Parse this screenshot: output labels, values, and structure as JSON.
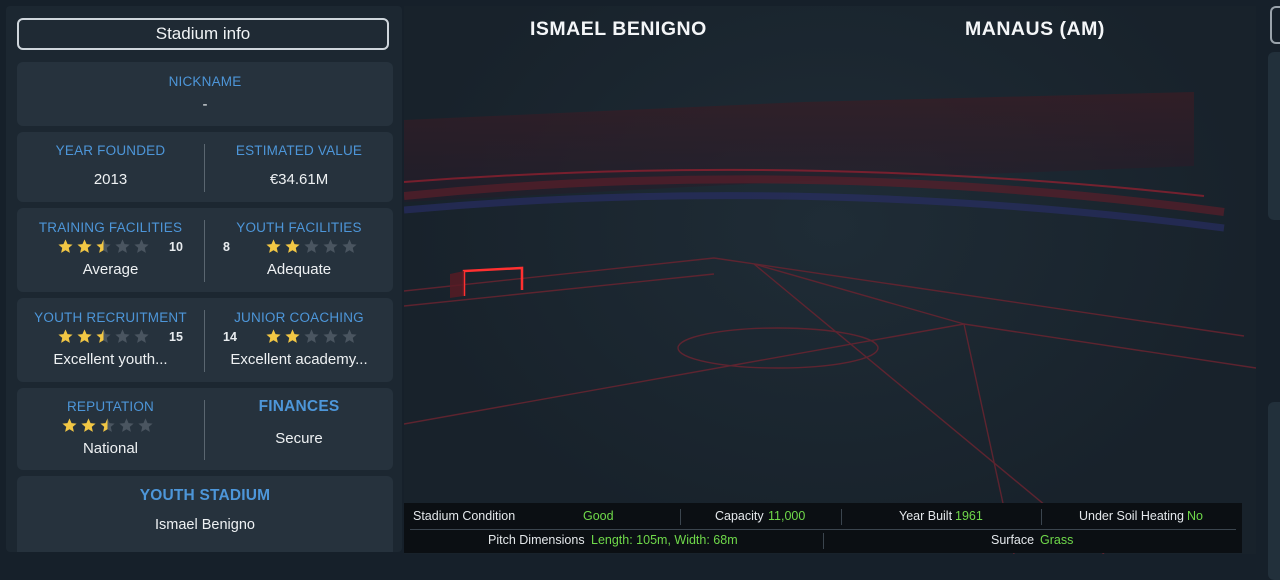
{
  "panel": {
    "stadium_button": "Stadium info",
    "nickname": {
      "label": "NICKNAME",
      "value": "-"
    },
    "year_founded": {
      "label": "YEAR FOUNDED",
      "value": "2013"
    },
    "estimated_value": {
      "label": "ESTIMATED VALUE",
      "value": "€34.61M"
    },
    "training_facilities": {
      "label": "TRAINING FACILITIES",
      "stars": 2.5,
      "number": "10",
      "rating": "Average"
    },
    "youth_facilities": {
      "label": "YOUTH FACILITIES",
      "stars": 2,
      "number": "8",
      "rating": "Adequate"
    },
    "youth_recruitment": {
      "label": "YOUTH RECRUITMENT",
      "stars": 2.5,
      "number": "15",
      "rating": "Excellent youth..."
    },
    "junior_coaching": {
      "label": "JUNIOR COACHING",
      "stars": 2,
      "number": "14",
      "rating": "Excellent academy..."
    },
    "reputation": {
      "label": "REPUTATION",
      "stars": 2.5,
      "rating": "National"
    },
    "finances": {
      "label": "FINANCES",
      "value": "Secure"
    },
    "youth_stadium": {
      "label": "YOUTH STADIUM",
      "value": "Ismael Benigno"
    }
  },
  "view": {
    "stadium_name": "ISMAEL BENIGNO",
    "city": "MANAUS (AM)"
  },
  "info_bar": {
    "condition_label": "Stadium Condition",
    "condition_value": "Good",
    "capacity_label": "Capacity",
    "capacity_value": "11,000",
    "year_built_label": "Year Built",
    "year_built_value": "1961",
    "heating_label": "Under Soil Heating",
    "heating_value": "No",
    "pitch_label": "Pitch Dimensions",
    "pitch_value": "Length: 105m, Width: 68m",
    "surface_label": "Surface",
    "surface_value": "Grass"
  },
  "colors": {
    "accent_label": "#4d96d9",
    "star_filled": "#f2c744",
    "star_empty": "#4a5560",
    "value_green": "#6fd94a"
  }
}
